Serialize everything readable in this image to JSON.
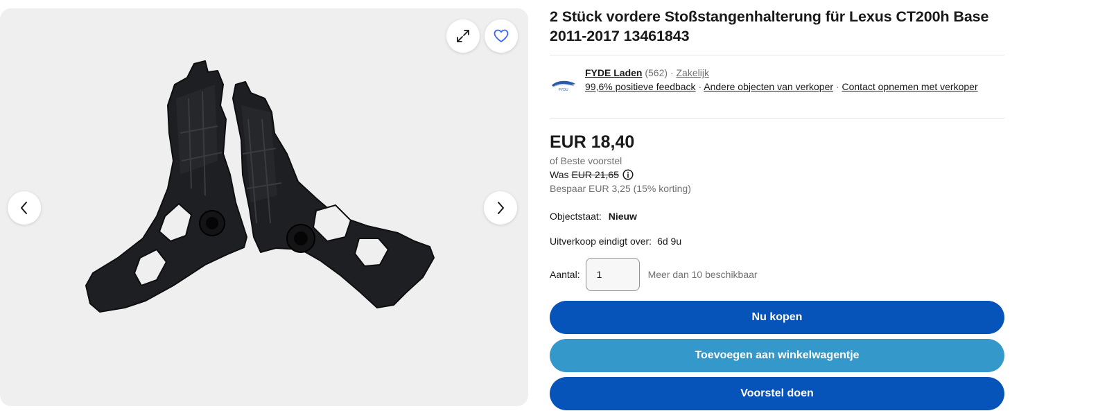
{
  "listing": {
    "title": "2 Stück vordere Stoßstangenhalterung für Lexus CT200h Base 2011-2017 13461843"
  },
  "gallery": {
    "image_alt": "Product photo: two black bumper brackets",
    "expand_icon": "expand-icon",
    "favorite_icon": "heart-icon",
    "prev_icon": "chevron-left-icon",
    "next_icon": "chevron-right-icon"
  },
  "seller": {
    "logo_text": "FYDU",
    "name": "FYDE Laden",
    "feedback_count": "(562)",
    "separator": "·",
    "type": "Zakelijk",
    "positive_feedback": "99,6% positieve feedback",
    "other_items": "Andere objecten van verkoper",
    "contact": "Contact opnemen met verkoper"
  },
  "pricing": {
    "price": "EUR 18,40",
    "best_offer": "of Beste voorstel",
    "was_label": "Was",
    "was_price": "EUR 21,65",
    "savings": "Bespaar EUR 3,25 (15% korting)"
  },
  "details": {
    "condition_label": "Objectstaat:",
    "condition_value": "Nieuw",
    "ends_label": "Uitverkoop eindigt over:",
    "ends_value": "6d 9u",
    "quantity_label": "Aantal:",
    "quantity_value": "1",
    "availability": "Meer dan 10 beschikbaar"
  },
  "actions": {
    "buy_now": "Nu kopen",
    "add_to_cart": "Toevoegen aan winkelwagentje",
    "make_offer": "Voorstel doen"
  },
  "colors": {
    "primary_button": "#0654ba",
    "secondary_button": "#3498ca",
    "gallery_bg": "#efefef",
    "muted_text": "#707070"
  }
}
